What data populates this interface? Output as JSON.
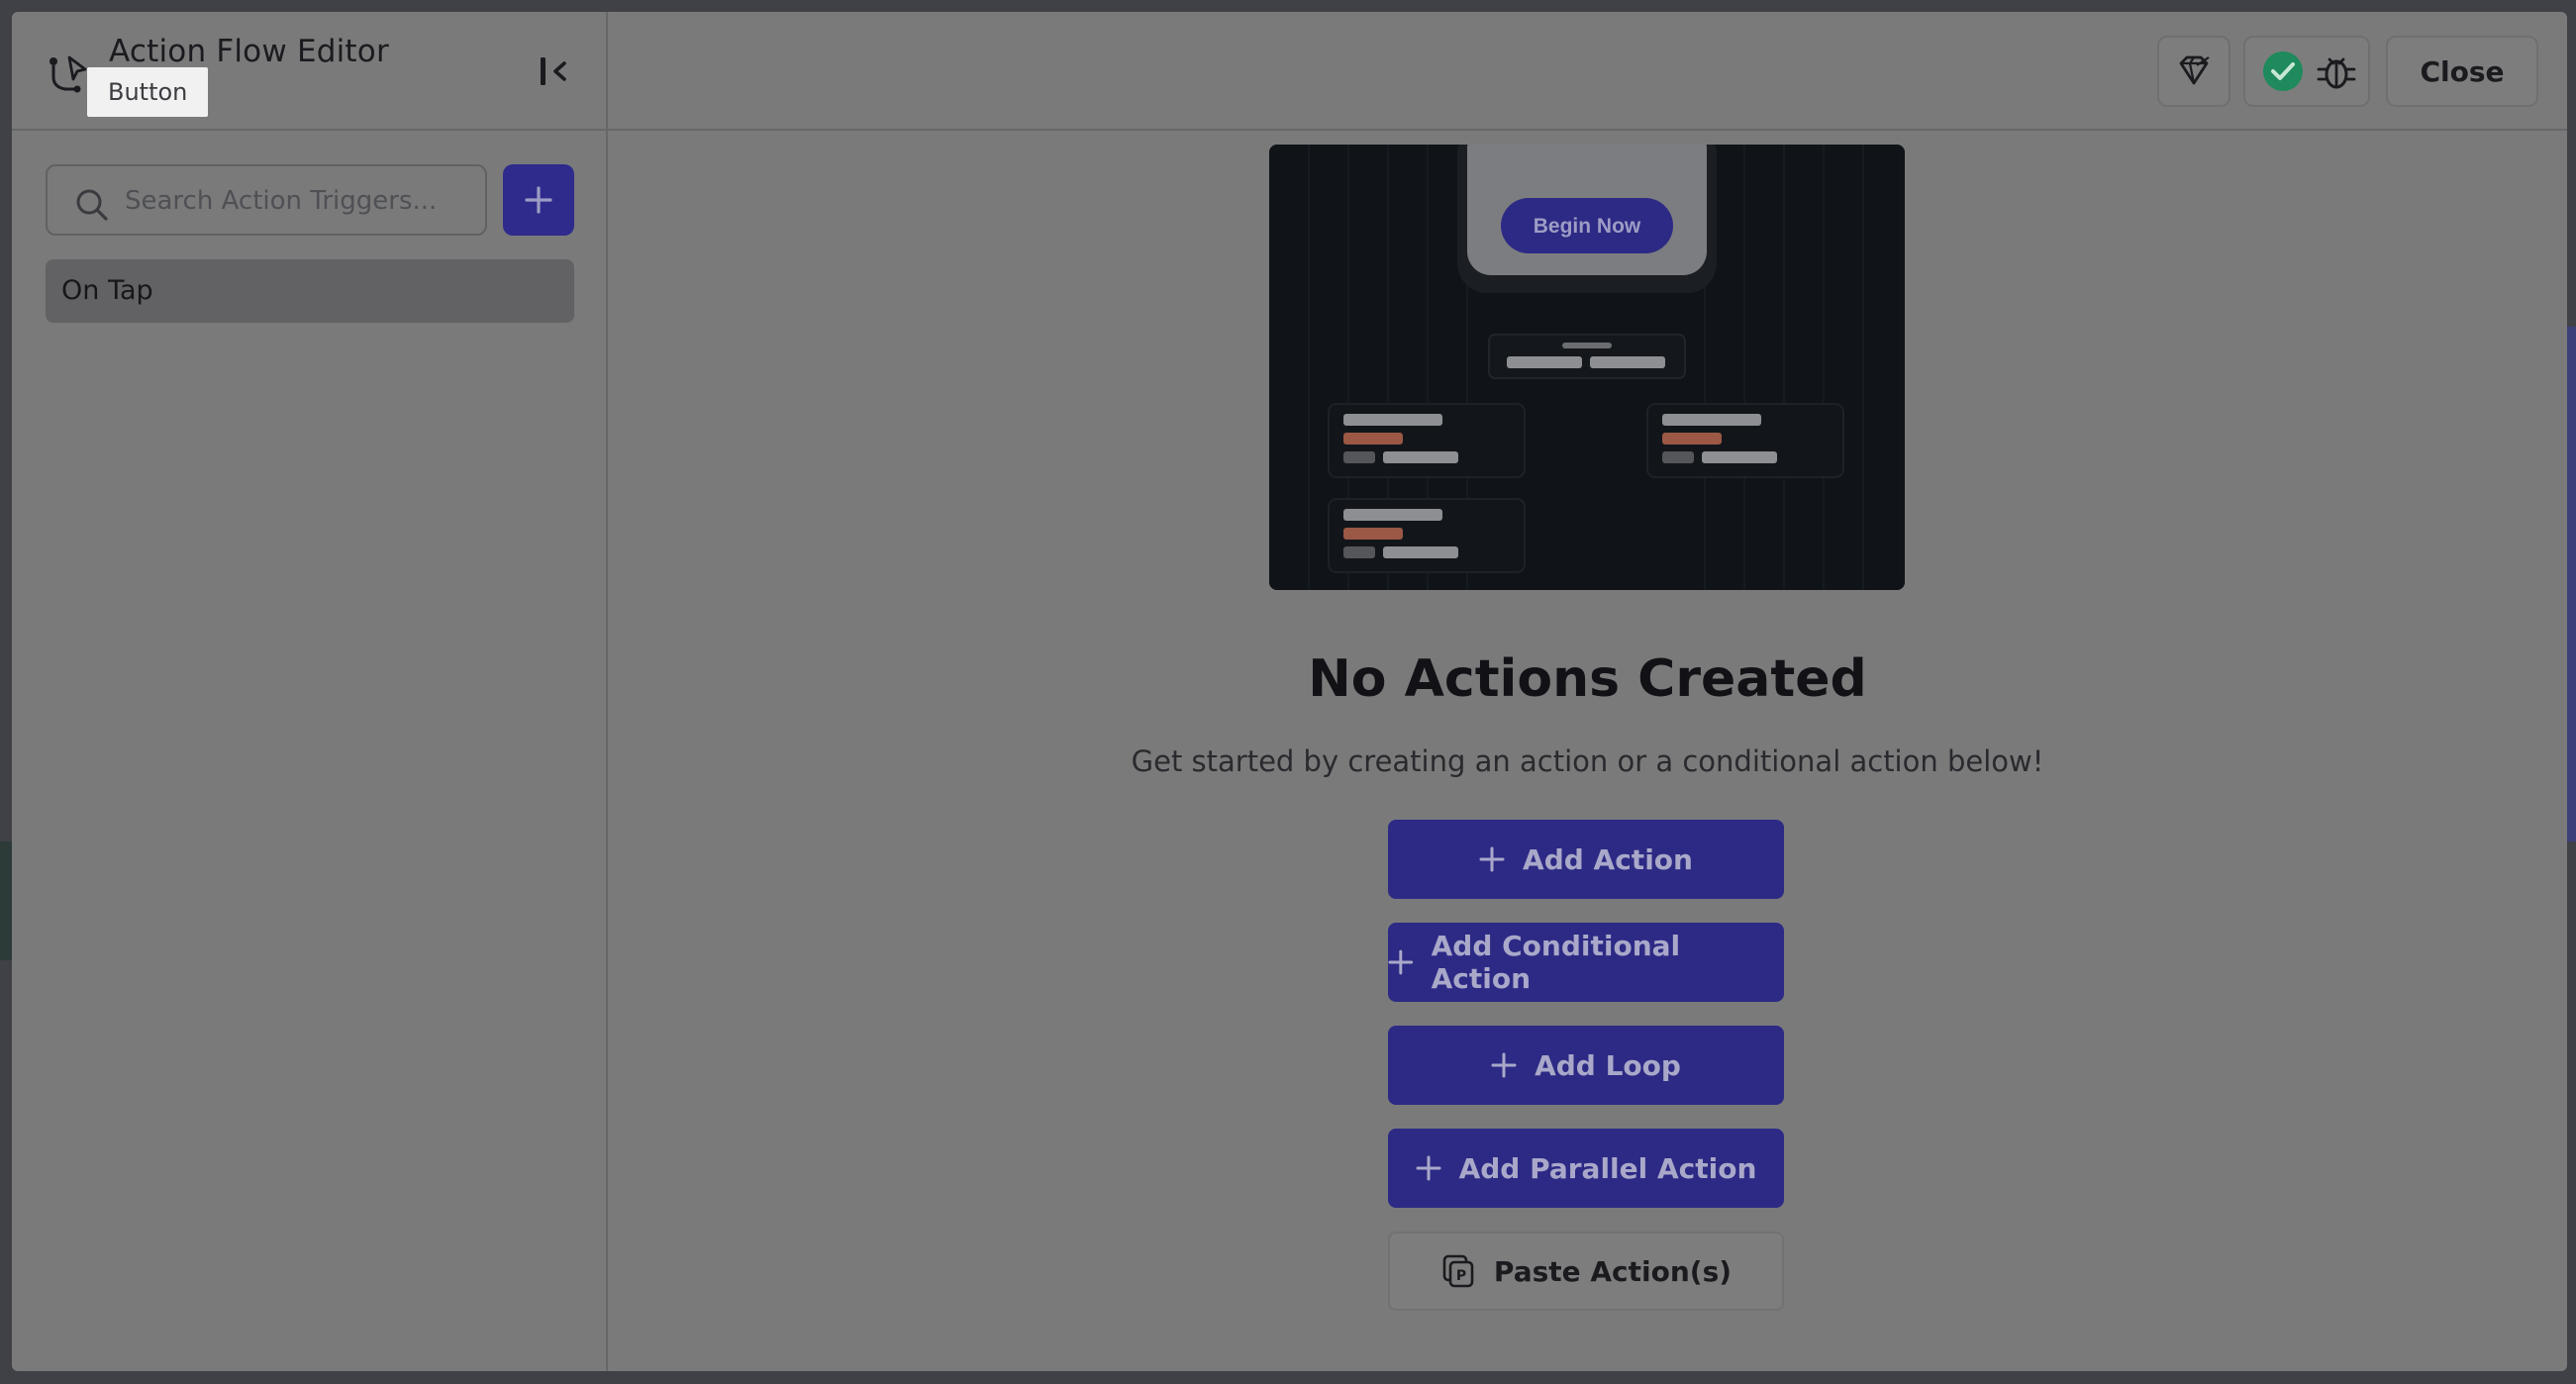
{
  "header": {
    "title": "Action Flow Editor",
    "tooltip": "Button"
  },
  "sidebar": {
    "search_placeholder": "Search Action Triggers...",
    "triggers": [
      {
        "label": "On Tap"
      }
    ]
  },
  "topbar": {
    "close_label": "Close",
    "status_color": "#1f8a5b"
  },
  "preview": {
    "button_label": "Begin Now"
  },
  "empty_state": {
    "title": "No Actions Created",
    "subtitle": "Get started by creating an action or a conditional action below!"
  },
  "actions": {
    "add_action": "Add Action",
    "add_conditional": "Add Conditional Action",
    "add_loop": "Add Loop",
    "add_parallel": "Add Parallel Action",
    "paste": "Paste Action(s)"
  },
  "colors": {
    "accent": "#2d2a85",
    "overlay": "#7a7a7b"
  }
}
